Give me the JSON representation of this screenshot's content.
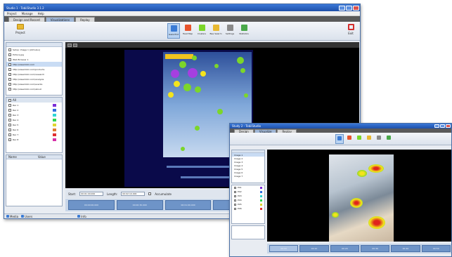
{
  "colors": {
    "titlebar": "#1e4fa8",
    "ribbon": "#dbe2ec",
    "stimulus_bg": "#000000",
    "timeline": "#6e94c8",
    "heat_green": "#7cd62a",
    "heat_purple": "#a53fe0",
    "heat_yellow": "#f4e41c",
    "heat_red": "#e0241c"
  },
  "window_a": {
    "title": "Studio 1 - TobiiStudio 3.1.2",
    "menu": [
      "Project",
      "Manage",
      "Help"
    ],
    "tabs": [
      "Design and Record",
      "Visualizations",
      "Replay"
    ],
    "ribbon": {
      "home_label": "Project",
      "tools": [
        {
          "label": "Gaze Plot",
          "icon": "gazeplot-icon"
        },
        {
          "label": "Heat Map",
          "icon": "heatmap-icon"
        },
        {
          "label": "Clusters",
          "icon": "clusters-icon"
        },
        {
          "label": "Bee Swarm",
          "icon": "beeswarm-icon"
        },
        {
          "label": "Settings",
          "icon": "settings-icon"
        },
        {
          "label": "Statistics",
          "icon": "statistics-icon"
        }
      ],
      "exit_label": "Exit"
    },
    "media_list": [
      "Setup: Image 1 (stimulus)",
      "Picture.jpg",
      "Web Browser 1",
      "http://www.tobii.com",
      "http://www.tobii.com/products",
      "http://www.tobii.com/research",
      "http://www.tobii.com/analysis",
      "http://www.tobii.com/events",
      "http://www.tobii.com/about"
    ],
    "participants_header": "All",
    "participants": [
      {
        "name": "Rec 1",
        "color": "#7b2fd6"
      },
      {
        "name": "Rec 2",
        "color": "#2f6fe0"
      },
      {
        "name": "Rec 3",
        "color": "#2fd6d6"
      },
      {
        "name": "Rec 4",
        "color": "#2fd652"
      },
      {
        "name": "Rec 5",
        "color": "#e0d62f"
      },
      {
        "name": "Rec 6",
        "color": "#e07a2f"
      },
      {
        "name": "Rec 7",
        "color": "#e02f2f"
      },
      {
        "name": "Rec 8",
        "color": "#d62fa8"
      }
    ],
    "filter_columns": [
      "Name",
      "Value"
    ],
    "controls": {
      "start_label": "Start:",
      "start_value": "00:01:40.000",
      "end_label": "Length:",
      "end_value": "00:02:10.000",
      "checkbox_label": "Accumulate"
    },
    "timeline": [
      "00:00:00.000",
      "00:00:30.000",
      "00:01:00.000",
      "00:01:30.000",
      "00:02:00.000",
      "00:02:30.000"
    ],
    "status": [
      "Media",
      "Users",
      "Info"
    ]
  },
  "window_b": {
    "title": "Study 2 - TobiiStudio",
    "tabs": [
      "Design",
      "Visualize",
      "Replay"
    ],
    "media_list": [
      "Image 1",
      "Image 2",
      "Image 3",
      "Image 4",
      "Image 5",
      "Image 6",
      "Image 7"
    ],
    "participants": [
      {
        "name": "P01",
        "color": "#7b2fd6"
      },
      {
        "name": "P02",
        "color": "#2f6fe0"
      },
      {
        "name": "P03",
        "color": "#2fd6d6"
      },
      {
        "name": "P04",
        "color": "#2fd652"
      },
      {
        "name": "P05",
        "color": "#e0d62f"
      },
      {
        "name": "P06",
        "color": "#e02f2f"
      }
    ],
    "timeline": [
      "00:00",
      "00:10",
      "00:20",
      "00:30",
      "00:40",
      "00:50"
    ]
  }
}
